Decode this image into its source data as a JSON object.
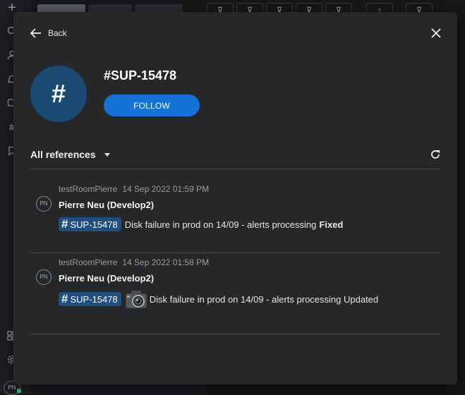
{
  "background": {
    "sidebar_icons": [
      "plus-icon",
      "search-icon",
      "users-icon",
      "bell-icon",
      "chat-icon",
      "hash-icon",
      "bookmark-icon",
      "apps-icon",
      "settings-icon"
    ],
    "avatar_initials": "PN"
  },
  "modal": {
    "back_label": "Back",
    "room": {
      "avatar_glyph": "#",
      "name": "#SUP-15478",
      "follow_label": "FOLLOW"
    },
    "filter_label": "All references",
    "references": [
      {
        "room": "testRoomPierre",
        "timestamp": "14 Sep 2022 01:59 PM",
        "avatar": "PN",
        "author": "Pierre Neu (Develop2)",
        "tag": "SUP-15478",
        "text": "Disk failure in prod on 14/09 - alerts processing",
        "status": "Fixed"
      },
      {
        "room": "testRoomPierre",
        "timestamp": "14 Sep 2022 01:58 PM",
        "avatar": "PN",
        "author": "Pierre Neu (Develop2)",
        "tag": "SUP-15478",
        "text": "Disk failure in prod on 14/09 - alerts processing Updated"
      }
    ]
  },
  "colors": {
    "modal_bg": "#262729",
    "accent": "#1473d6",
    "tag_bg": "#1e4f82",
    "avatar_bg": "#1b4a73"
  }
}
